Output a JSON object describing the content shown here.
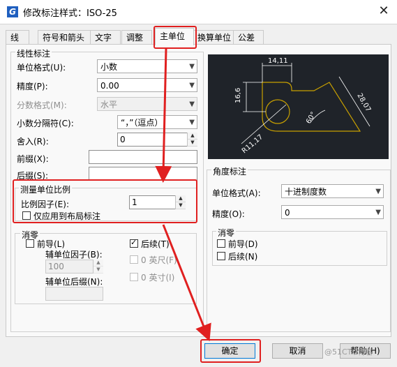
{
  "window": {
    "title": "修改标注样式：ISO-25",
    "close_symbol": "✕",
    "app_icon_letter": "G"
  },
  "tabs": [
    "线",
    "符号和箭头",
    "文字",
    "调整",
    "主单位",
    "换算单位",
    "公差"
  ],
  "linear": {
    "group_title": "线性标注",
    "unit_format_label": "单位格式(U):",
    "unit_format_value": "小数",
    "precision_label": "精度(P):",
    "precision_value": "0.00",
    "fraction_label": "分数格式(M):",
    "fraction_value": "水平",
    "decimal_sep_label": "小数分隔符(C):",
    "decimal_sep_value": "“，”（逗点）",
    "round_label": "舍入(R):",
    "round_value": "0",
    "prefix_label": "前缀(X):",
    "suffix_label": "后缀(S):"
  },
  "scale": {
    "group_title": "测量单位比例",
    "factor_label": "比例因子(E):",
    "factor_value": "1",
    "layout_only_label": "仅应用到布局标注"
  },
  "zero": {
    "group_title": "消零",
    "leading_label": "前导(L)",
    "trailing_label": "后续(T)",
    "sub_factor_label": "辅单位因子(B):",
    "sub_factor_value": "100",
    "feet_label": "0 英尺(F)",
    "inch_label": "0 英寸(I)",
    "sub_suffix_label": "辅单位后缀(N):"
  },
  "preview": {
    "dim_top": "14,11",
    "dim_left": "16,6",
    "dim_right": "28,07",
    "dim_angle": "60°",
    "dim_radius": "R11,17"
  },
  "angular": {
    "group_title": "角度标注",
    "unit_format_label": "单位格式(A):",
    "unit_format_value": "十进制度数",
    "precision_label": "精度(O):",
    "precision_value": "0"
  },
  "angular_zero": {
    "group_title": "消零",
    "leading_label": "前导(D)",
    "trailing_label": "后续(N)"
  },
  "buttons": {
    "ok": "确定",
    "cancel": "取消",
    "help": "帮助(H)"
  },
  "watermark": "@51CTO博客",
  "colors": {
    "highlight": "#e02020",
    "preview_bg": "#1f2329",
    "preview_geometry": "#c8a000"
  }
}
